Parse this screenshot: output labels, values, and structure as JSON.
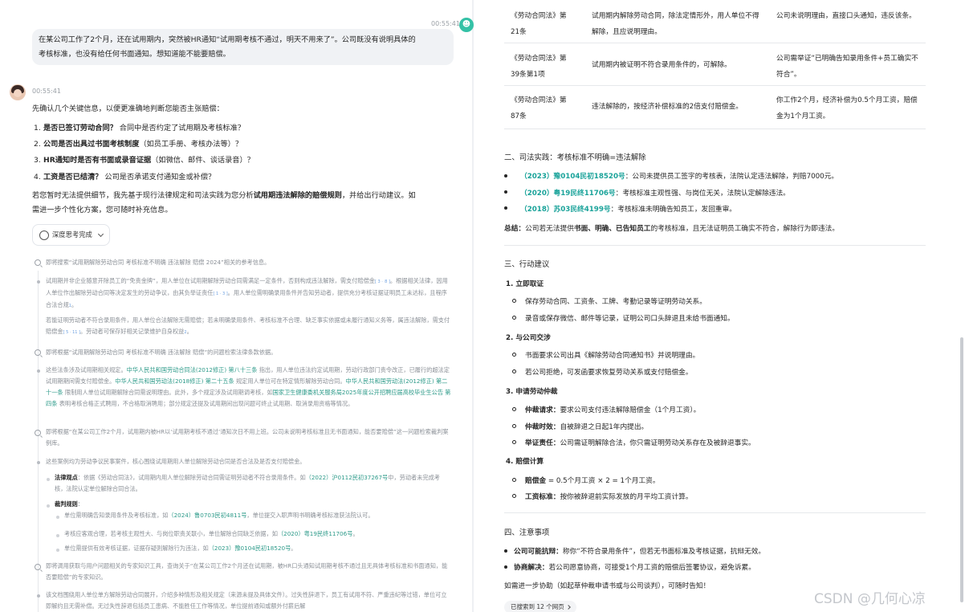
{
  "user_msg": {
    "time": "00:55:41",
    "line1": "在某公司工作了2个月，还在试用期内，突然被HR通知“试用期考核不通过，明天不用来了”。公司既没有说明具体的",
    "line2": "考核标准，也没有给任何书面通知。想知道能不能要赔偿。"
  },
  "assistant": {
    "time": "00:55:41",
    "intro": "先确认几个关键信息，以便更准确地判断您能否主张赔偿：",
    "questions": [
      {
        "num": "1.",
        "bold": "是否已签订劳动合同？",
        "rest": " 合同中是否约定了试用期及考核标准？"
      },
      {
        "num": "2.",
        "bold": "公司是否出具过书面考核制度",
        "rest": "（如员工手册、考核办法等）？"
      },
      {
        "num": "3.",
        "bold": "HR通知时是否有书面或录音证据",
        "rest": "（如微信、邮件、谈话录音）？"
      },
      {
        "num": "4.",
        "bold": "工资是否已结清？",
        "rest": " 公司是否承诺支付通知金或补偿？"
      }
    ],
    "para_a": "若您暂时无法提供细节，我先基于现行法律规定和司法实践为您分析",
    "para_b": "试用期违法解除的赔偿规则",
    "para_c": "，并给出行动建议。如",
    "para2": "需进一步个性化方案，您可随时补充信息。",
    "think_label": "深度思考完成"
  },
  "thinking": {
    "s1": "即将搜索“试用期解除劳动合同 考核标准不明确 违法解除 赔偿 2024”相关的参考信息。",
    "b1": "试用期并非企业随意开除员工的“免责金牌”，用人单位在试用期解除劳动合同需满足一定条件，否则构成违法解除，需支付赔偿金",
    "b1_sup1": "[ 3 ·",
    "b1_sup2": "8 ]",
    "b1_l2": "。根据相关法律，因用人单位作出解除劳动合同等决定发生的劳动争议，由其负举证责任",
    "b1_sup3": "[ 1 · 3 ]",
    "b1_l2b": "。用人单位需明确录用条件并告知",
    "b1_l3": "劳动者，提供充分考核证据证明员工未达标，且程序合法合规",
    "b1_sup4": "1",
    "p1a": "若能证明劳动者不符合录用条件，用人单位合法解除无需赔偿；若未明确录用条件、考核标准不合理、缺乏事实依据或未履行通知义",
    "p1b": "务等，属违法解除，需支付赔偿金",
    "p1_sup": "[ 5 · 11 ]",
    "p1c": "。劳动者可保存好相关记录维护自身权益",
    "p1_sup2": "2",
    "s2": "即将根据“试用期解除劳动合同 考核标准不明确 违法解除 赔偿”的问题检索法律条款依据。",
    "b2a": "这些法条涉及试用期相关规定。",
    "b2_link1": "中华人民共和国劳动合同法(2012修正) 第八十三条",
    "b2b": "指出，用人单位违法约定试用期，劳动行政部门",
    "b2c": "责令改正，已履行的超法定试用期期间需支付赔偿金。",
    "b2_link2": "中华人民共和国劳动法(2018修正) 第二十五条",
    "b2d": "规定用人单位可在特定情形解",
    "b2e": "除劳动合同。",
    "b2_link3": "中华人民共和国劳动法(2012修正) 第二十一条",
    "b2f": "限制用人单位试用期解除合同需说明理由。此外，多个规定",
    "b2g": "涉及试用期调考核，如",
    "b2_link4": "国家卫生健康委机关服务局2025年度公开招聘应届高校毕业生公告 第四条",
    "b2h": "表明考核合格正式聘用，不合格取",
    "b2i": "消聘用；部分规定还提及试用期间出现问题可终止试用期、取消录用资格等情况。",
    "s3a": "即将根据“在某公司工作2个月，试用期内被HR以‘试用期考核不通过’通知次日不用上班。公司未说明考核标准且无书面通知，能否要",
    "s3b": "赔偿”这一问题检索裁判案例库。",
    "b3": "这些案例均为劳动争议民事案件，核心围绕试用期用人单位解除劳动合同是否合法及是否支付赔偿金。",
    "law_bold": "法律观点",
    "law_a": "：依据《劳动合同法》，试用期内用人单位解除劳动合同需证明劳动者不符合录用条件。如",
    "law_link": "（2022）沪0112民初37267号",
    "law_b": "中，劳动者未完成考核，法院认定单位解除合同合法。",
    "rule_bold": "裁判规则",
    "r1a": "单位需明确告知录用条件及考核标准，如",
    "r1_link": "（2024）鲁0703民初4811号",
    "r1b": "，单位提交入职声明书明确考核标准获法院认可。",
    "r2a": "考核应客观合理，若考核主观性大、与岗位职责关联小，单位解除合同缺乏依据，如",
    "r2_link": "（2020）粤19民终11706号",
    "r2b": "。",
    "r3a": "单位需提供有效考核证据，证据存疑则解除行为违法，如",
    "r3_link": "（2023）豫0104民初18520号",
    "r3b": "。",
    "s4a": "即将调用获取与用户问题相关的专家知识工具，查询关于“在某公司工作2个月还在试用期，被HR口头通知试用期考核不通过且无具",
    "s4b": "体考核标准和书面通知，能否要赔偿”的专家知识。",
    "b4a": "该文档围绕用人单位单方解除劳动合同展开，介绍多种情形及相关规定（来源未提及具体文件）。过失性辞退下，员工有试用不符、",
    "b4b": "严重违纪等过错，单位可立即解约且无需补偿。无过失性辞退包括员工患病、不能胜任工作等情况，单位提前通知或额外付薪后解"
  },
  "law_table": [
    {
      "law_a": "《劳动合同法》第",
      "law_b": "21条",
      "content": "试用期内解除劳动合同，除法定情形外，用人单位不得解除，且应说明理由。",
      "case": "公司未说明理由，直接口头通知，违反该条。"
    },
    {
      "law_a": "《劳动合同法》第",
      "law_b": "39条第1项",
      "content": "试用期内被证明不符合录用条件的，可解除。",
      "case": "公司需举证“已明确告知录用条件+员工确实不符合”。"
    },
    {
      "law_a": "《劳动合同法》第",
      "law_b": "87条",
      "content": "违法解除的，按经济补偿标准的2倍支付赔偿金。",
      "case": "你工作2个月，经济补偿为0.5个月工资，赔偿金为1个月工资。"
    }
  ],
  "section2": {
    "title": "二、司法实践：考核标准不明确=违法解除",
    "items": [
      {
        "link": "（2023）豫0104民初18520号",
        "text": "：公司未提供员工签字的考核表，法院认定违法解除，判赔7000元。"
      },
      {
        "link": "（2020）粤19民终11706号",
        "text": "：考核标准主观性强、与岗位无关，法院认定解除违法。"
      },
      {
        "link": "（2018）苏03民终4199号",
        "text": "：考核标准未明确告知员工，发回重审。"
      }
    ],
    "sum_a": "总结：",
    "sum_b": "公司若无法提供",
    "sum_c": "书面、明确、已告知员工",
    "sum_d": "的考核标准，且无法证明员工确实不符合，解除行为即违法。"
  },
  "section3": {
    "title": "三、行动建议",
    "g1": "1. 立即取证",
    "g1_items": [
      "保存劳动合同、工资条、工牌、考勤记录等证明劳动关系。",
      "录音或保存微信、邮件等记录，证明公司口头辞退且未给书面通知。"
    ],
    "g2": "2. 与公司交涉",
    "g2_items": [
      "书面要求公司出具《解除劳动合同通知书》并说明理由。",
      "若公司拒绝，可发函要求恢复劳动关系或支付赔偿金。"
    ],
    "g3": "3. 申请劳动仲裁",
    "g3_items": [
      {
        "bold": "仲裁请求：",
        "rest": "要求公司支付违法解除赔偿金（1个月工资）。"
      },
      {
        "bold": "仲裁时效：",
        "rest": "自被辞退之日起1年内提出。"
      },
      {
        "bold": "举证责任：",
        "rest": "公司需证明解除合法，你只需证明劳动关系存在及被辞退事实。"
      }
    ],
    "g4": "4. 赔偿计算",
    "g4_items": [
      {
        "bold": "赔偿金",
        "rest": " = 0.5个月工资 × 2 = 1个月工资。"
      },
      {
        "bold": "工资标准：",
        "rest": "按你被辞退前实际发放的月平均工资计算。"
      }
    ]
  },
  "section4": {
    "title": "四、注意事项",
    "items": [
      {
        "bold": "公司可能抗辩：",
        "rest": "称你“不符合录用条件”，但若无书面标准及考核证据，抗辩无效。"
      },
      {
        "bold": "协商解决：",
        "rest": "若公司愿意协商，可接受1个月工资的赔偿后签署协议，避免诉累。"
      }
    ],
    "closing": "如需进一步协助（如起草仲裁申请书或与公司谈判），可随时告知！",
    "sources": "已搜索到 12 个网页"
  },
  "watermark": "CSDN @几何心凉"
}
